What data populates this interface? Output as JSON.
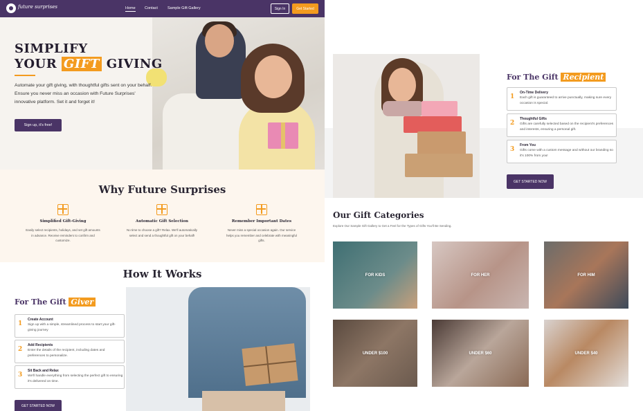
{
  "nav": {
    "logo": "future surprises",
    "links": [
      "Home",
      "Contact",
      "Sample Gift Gallery"
    ],
    "signin": "Sign In",
    "getstarted": "Get Started"
  },
  "hero": {
    "title_line1": "SIMPLIFY",
    "title_line2_a": "YOUR",
    "title_line2_hl": "GIFT",
    "title_line2_b": "GIVING",
    "text": "Automate your gift giving, with thoughtful gifts sent on your behalf. Ensure you never miss an occasion with Future Surprises' innovative platform.  Set it and forget it!",
    "button": "Sign up, it's free!"
  },
  "why": {
    "title": "Why Future Surprises",
    "features": [
      {
        "title": "Simplified Gift-Giving",
        "desc": "Easily select recipients, holidays, and set gift amounts in advance. Receive reminders to confirm and customize."
      },
      {
        "title": "Automatic Gift Selection",
        "desc": "No time to choose a gift? Relax. We'll automatically select and send a thoughtful gift on your behalf!"
      },
      {
        "title": "Remember Important Dates",
        "desc": "Never miss a special occasion again. Our service helps you remember and celebrate with meaningful gifts."
      }
    ]
  },
  "how": {
    "title": "How It Works",
    "giver_title_a": "For The Gift",
    "giver_title_hl": "Giver",
    "steps": [
      {
        "num": "1",
        "title": "Create Account",
        "desc": "Sign up with a simple, streamlined process to start your gift-giving journey"
      },
      {
        "num": "2",
        "title": "Add Recipients",
        "desc": "Enter the details of the recipient, including dates and preferences to personalize."
      },
      {
        "num": "3",
        "title": "Sit Back and Relax",
        "desc": "We'll handle everything from selecting the perfect gift to ensuring it's delivered on time."
      }
    ],
    "button": "GET STARTED NOW"
  },
  "recipient": {
    "title_a": "For The Gift",
    "title_hl": "Recipient",
    "steps": [
      {
        "num": "1",
        "title": "On-Time Delivery",
        "desc": "Each gift is guaranteed to arrive punctually, making sure every occasion is special."
      },
      {
        "num": "2",
        "title": "Thoughtful Gifts",
        "desc": "Gifts are carefully selected based on the recipient's preferences and interests, ensuring a personal gift."
      },
      {
        "num": "3",
        "title": "From You",
        "desc": "Gifts come with a custom message and without our branding so it's 100% from you!"
      }
    ],
    "button": "GET STARTED NOW"
  },
  "categories": {
    "title": "Our Gift Categories",
    "subtitle": "Explore Our Sample Gift Gallery to Get a Feel for the Types of Gifts You'll Be Sending.",
    "items": [
      "FOR KIDS",
      "FOR HER",
      "FOR HIM",
      "UNDER $100",
      "UNDER $60",
      "UNDER $40"
    ]
  }
}
